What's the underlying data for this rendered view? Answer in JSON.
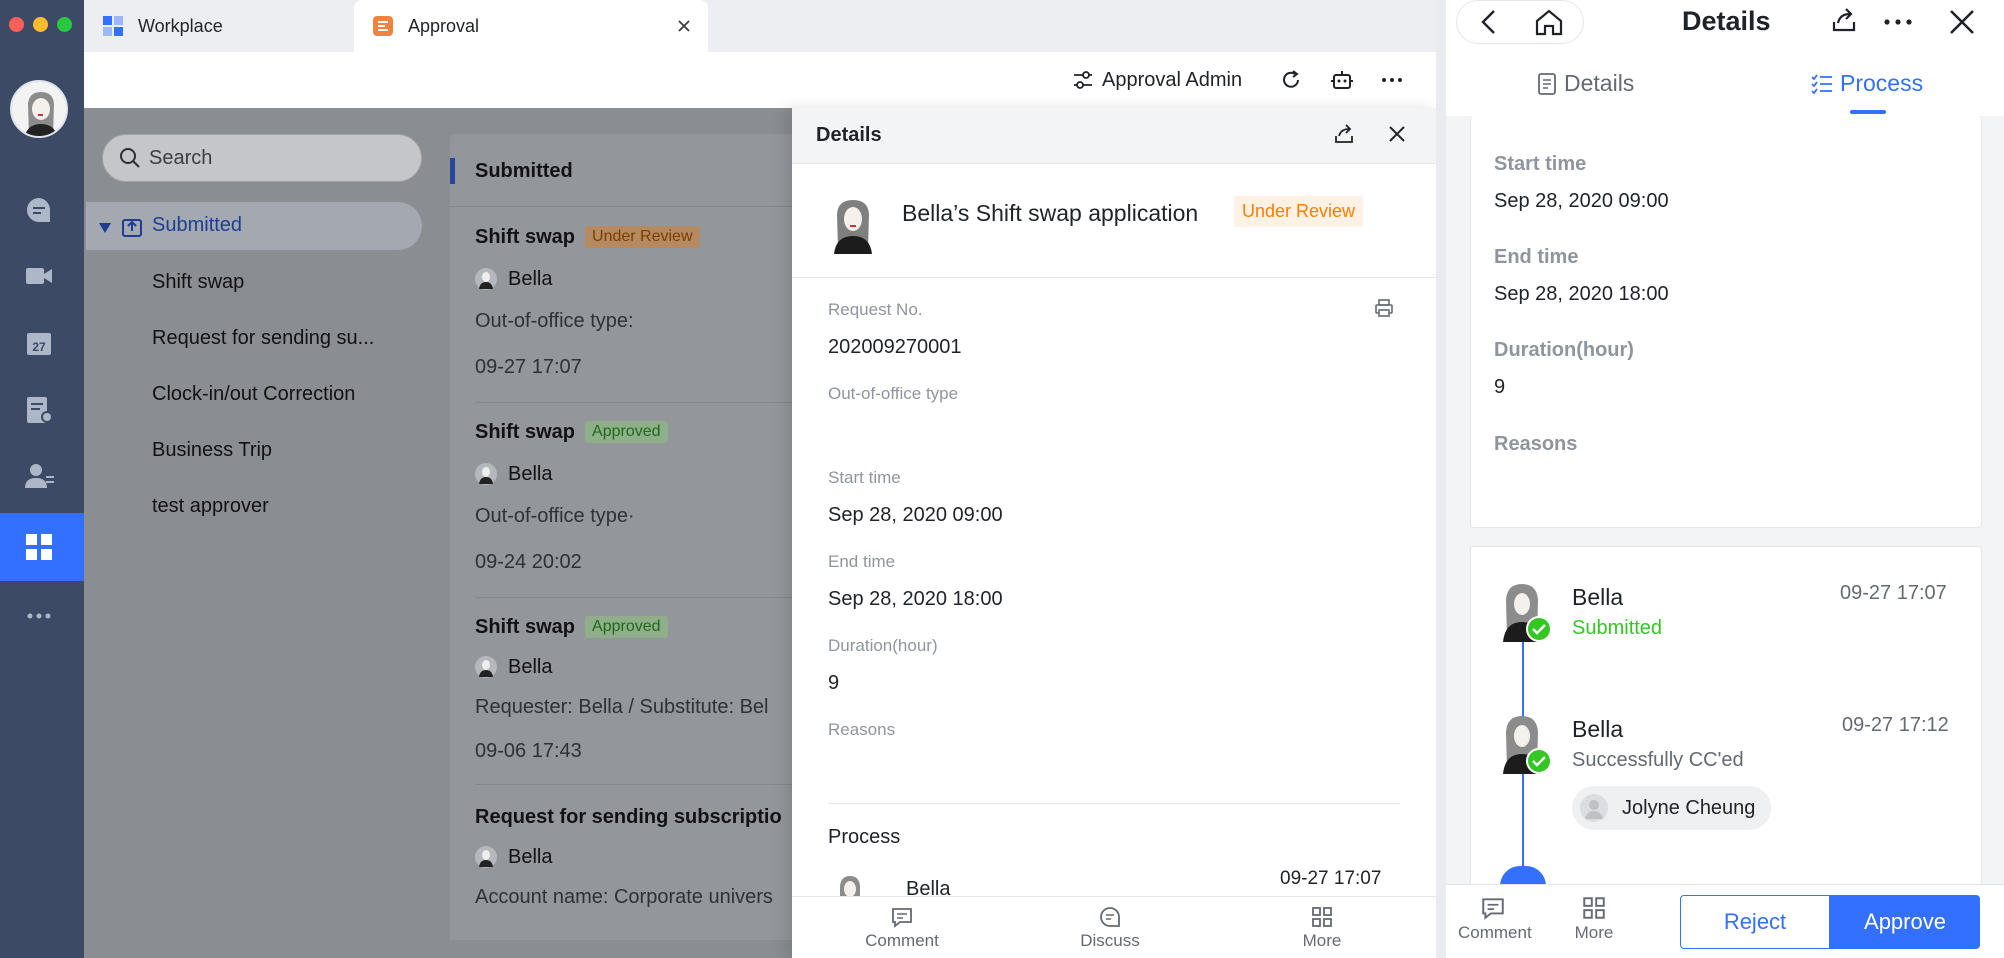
{
  "window": {
    "tabs": [
      {
        "label": "Workplace"
      },
      {
        "label": "Approval"
      }
    ]
  },
  "toolbar": {
    "admin_label": "Approval Admin"
  },
  "sidebar": {
    "search_placeholder": "Search",
    "group_label": "Submitted",
    "items": [
      {
        "label": "Shift swap"
      },
      {
        "label": "Request for sending su..."
      },
      {
        "label": "Clock-in/out Correction"
      },
      {
        "label": "Business Trip"
      },
      {
        "label": "test approver"
      }
    ]
  },
  "list": {
    "header": "Submitted",
    "cards": [
      {
        "title": "Shift swap",
        "status": "Under Review",
        "user": "Bella",
        "desc": "Out-of-office type:",
        "time": "09-27 17:07"
      },
      {
        "title": "Shift swap",
        "status": "Approved",
        "user": "Bella",
        "desc": "Out-of-office type·",
        "time": "09-24 20:02"
      },
      {
        "title": "Shift swap",
        "status": "Approved",
        "user": "Bella",
        "desc": "Requester: Bella / Substitute: Bel",
        "time": "09-06 17:43"
      },
      {
        "title": "Request for sending subscriptio",
        "status": "",
        "user": "Bella",
        "desc": "Account name: Corporate univers",
        "time": ""
      }
    ]
  },
  "drawer": {
    "title": "Details",
    "app_title": "Bella’s Shift swap application",
    "status": "Under Review",
    "fields": [
      {
        "label": "Request No.",
        "value": "202009270001"
      },
      {
        "label": "Out-of-office type",
        "value": ""
      },
      {
        "label": "Start time",
        "value": "Sep 28, 2020 09:00"
      },
      {
        "label": "End time",
        "value": "Sep 28, 2020 18:00"
      },
      {
        "label": "Duration(hour)",
        "value": "9"
      },
      {
        "label": "Reasons",
        "value": ""
      }
    ],
    "process_title": "Process",
    "process_user": "Bella",
    "process_time": "09-27 17:07",
    "bottom": [
      {
        "label": "Comment"
      },
      {
        "label": "Discuss"
      },
      {
        "label": "More"
      }
    ]
  },
  "mobile": {
    "title": "Details",
    "tabs": [
      {
        "label": "Details"
      },
      {
        "label": "Process"
      }
    ],
    "fields": [
      {
        "label": "Start time",
        "value": "Sep 28, 2020 09:00"
      },
      {
        "label": "End time",
        "value": "Sep 28, 2020 18:00"
      },
      {
        "label": "Duration(hour)",
        "value": "9"
      },
      {
        "label": "Reasons",
        "value": ""
      }
    ],
    "timeline": [
      {
        "name": "Bella",
        "action": "Submitted",
        "time": "09-27 17:07"
      },
      {
        "name": "Bella",
        "action": "Successfully CC'ed",
        "time": "09-27 17:12",
        "cc": "Jolyne Cheung"
      }
    ],
    "bottom": {
      "comment": "Comment",
      "more": "More",
      "reject": "Reject",
      "approve": "Approve"
    }
  },
  "colors": {
    "accent": "#3370ff",
    "under_review": "#ff7d00",
    "approved": "#34c724"
  }
}
